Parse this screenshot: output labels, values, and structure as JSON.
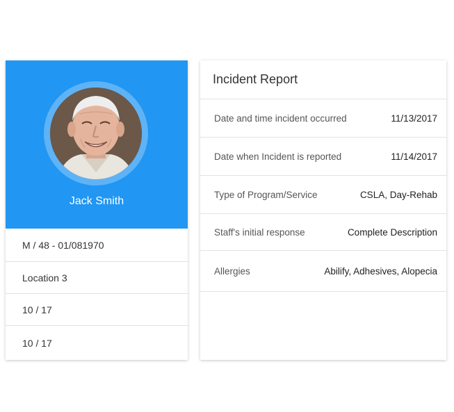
{
  "patient": {
    "name": "Jack Smith",
    "details": [
      "M / 48 - 01/081970",
      "Location 3",
      "10 / 17",
      "10 / 17"
    ],
    "accent_color": "#2196f3"
  },
  "report": {
    "title": "Incident Report",
    "rows": [
      {
        "label": "Date and time incident occurred",
        "value": "11/13/2017"
      },
      {
        "label": "Date when Incident is reported",
        "value": "11/14/2017"
      },
      {
        "label": "Type of Program/Service",
        "value": "CSLA, Day-Rehab"
      },
      {
        "label": "Staff's initial response",
        "value": "Complete Description"
      },
      {
        "label": "Allergies",
        "value": "Abilify, Adhesives, Alopecia"
      }
    ]
  }
}
